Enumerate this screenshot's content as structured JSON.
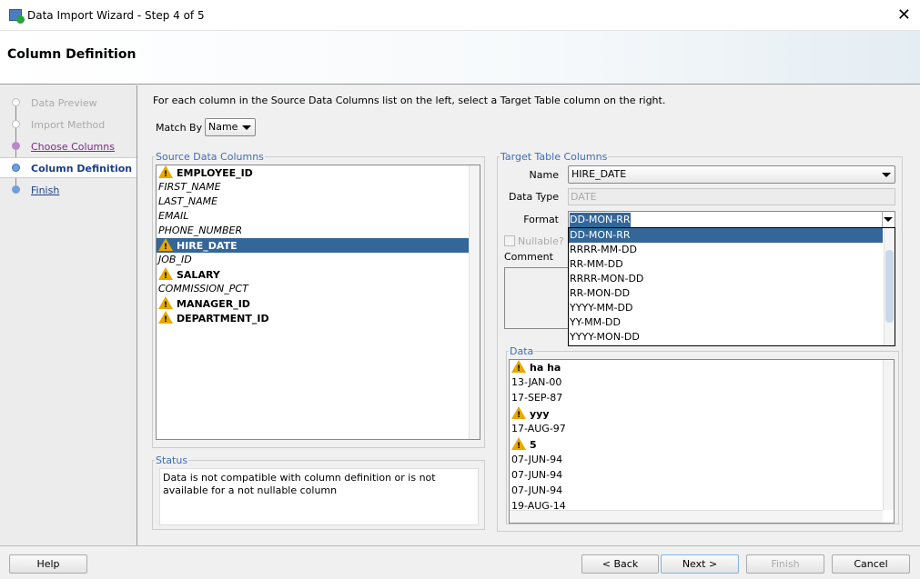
{
  "window": {
    "title": "Data Import Wizard - Step 4 of 5",
    "close": "✕"
  },
  "header": {
    "title": "Column Definition"
  },
  "nav": {
    "steps": [
      {
        "label": "Data Preview",
        "state": "disabled"
      },
      {
        "label": "Import Method",
        "state": "disabled"
      },
      {
        "label": "Choose Columns",
        "state": "visited"
      },
      {
        "label": "Column Definition",
        "state": "current"
      },
      {
        "label": "Finish",
        "state": "link"
      }
    ]
  },
  "main": {
    "instruction": "For each column in the Source Data Columns list on the left, select a Target Table column on the right.",
    "match_by_label": "Match By",
    "match_by_value": "Name"
  },
  "source": {
    "legend": "Source Data Columns",
    "columns": [
      {
        "name": "EMPLOYEE_ID",
        "warn": true
      },
      {
        "name": "FIRST_NAME",
        "warn": false
      },
      {
        "name": "LAST_NAME",
        "warn": false
      },
      {
        "name": "EMAIL",
        "warn": false
      },
      {
        "name": "PHONE_NUMBER",
        "warn": false
      },
      {
        "name": "HIRE_DATE",
        "warn": true,
        "selected": true
      },
      {
        "name": "JOB_ID",
        "warn": false
      },
      {
        "name": "SALARY",
        "warn": true
      },
      {
        "name": "COMMISSION_PCT",
        "warn": false
      },
      {
        "name": "MANAGER_ID",
        "warn": true
      },
      {
        "name": "DEPARTMENT_ID",
        "warn": true
      }
    ]
  },
  "status": {
    "legend": "Status",
    "text": "Data is not compatible with column definition or is not available for a not nullable column"
  },
  "target": {
    "legend": "Target Table Columns",
    "name_label": "Name",
    "name_value": "HIRE_DATE",
    "type_label": "Data Type",
    "type_value": "DATE",
    "format_label": "Format",
    "format_value": "DD-MON-RR",
    "nullable_label": "Nullable?",
    "comment_label": "Comment",
    "format_options": [
      "DD-MON-RR",
      "RRRR-MM-DD",
      "RR-MM-DD",
      "RRRR-MON-DD",
      "RR-MON-DD",
      "YYYY-MM-DD",
      "YY-MM-DD",
      "YYYY-MON-DD"
    ]
  },
  "data": {
    "legend": "Data",
    "rows": [
      {
        "v": "ha ha",
        "warn": true
      },
      {
        "v": "13-JAN-00",
        "warn": false
      },
      {
        "v": "17-SEP-87",
        "warn": false
      },
      {
        "v": "yyy",
        "warn": true
      },
      {
        "v": "17-AUG-97",
        "warn": false
      },
      {
        "v": "5",
        "warn": true
      },
      {
        "v": "07-JUN-94",
        "warn": false
      },
      {
        "v": "07-JUN-94",
        "warn": false
      },
      {
        "v": "07-JUN-94",
        "warn": false
      },
      {
        "v": "19-AUG-14",
        "warn": false
      }
    ]
  },
  "buttons": {
    "help": "Help",
    "back": "< Back",
    "next": "Next >",
    "finish": "Finish",
    "cancel": "Cancel"
  },
  "colors": {
    "selection": "#336699",
    "legend": "#3e6db5",
    "warning": "#e8a800"
  }
}
